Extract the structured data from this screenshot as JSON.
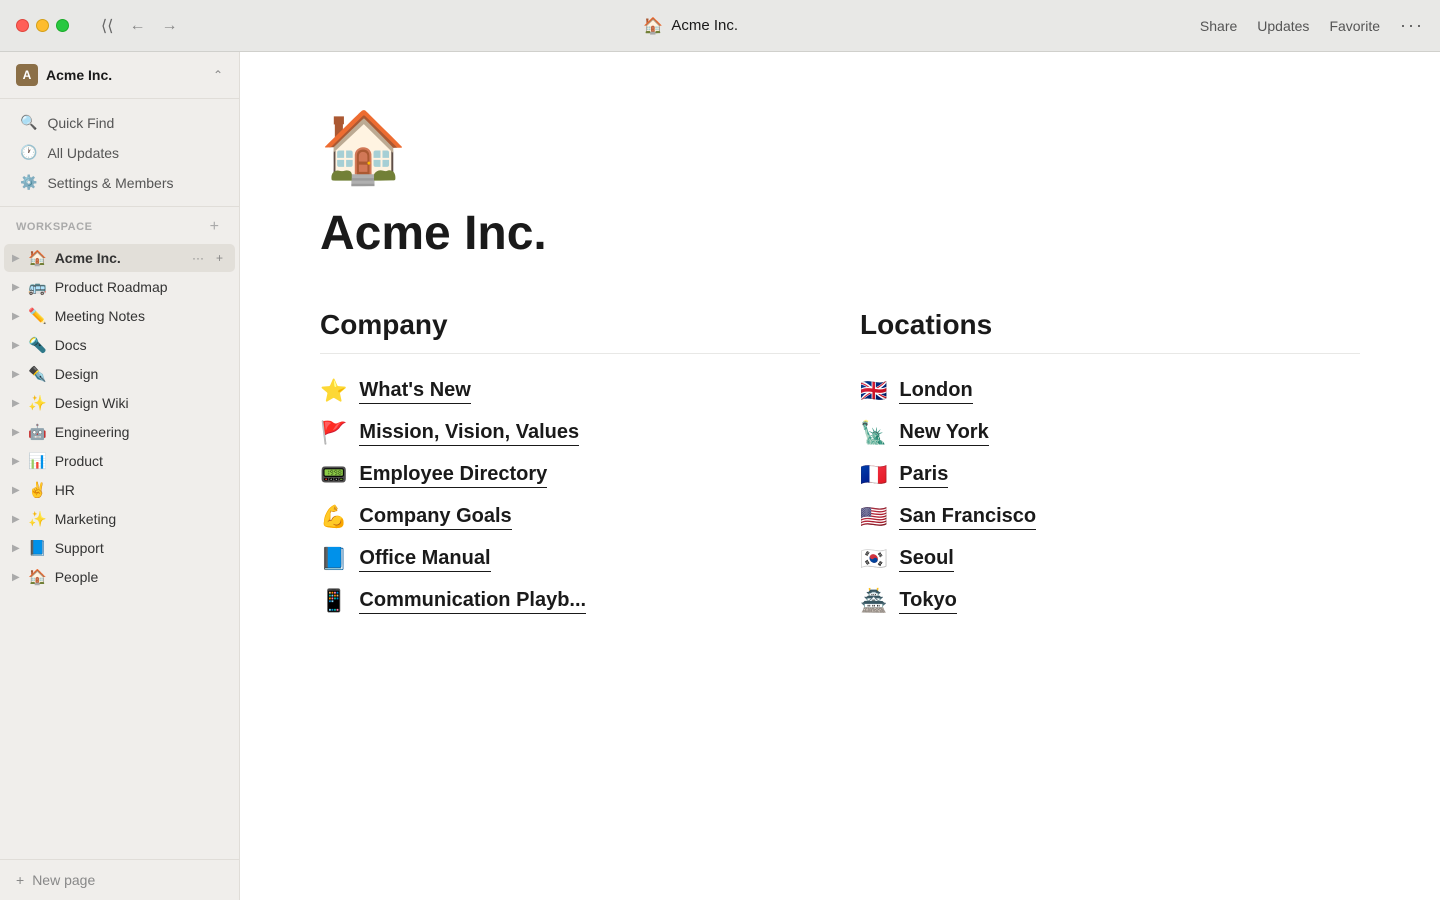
{
  "titlebar": {
    "collapse_label": "⟨⟨",
    "back_label": "←",
    "forward_label": "→",
    "page_emoji": "🏠",
    "page_title": "Acme Inc.",
    "share_label": "Share",
    "updates_label": "Updates",
    "favorite_label": "Favorite",
    "more_label": "···"
  },
  "sidebar": {
    "workspace_icon": "A",
    "workspace_name": "Acme Inc.",
    "nav_items": [
      {
        "id": "quick-find",
        "icon": "🔍",
        "label": "Quick Find"
      },
      {
        "id": "all-updates",
        "icon": "🕐",
        "label": "All Updates"
      },
      {
        "id": "settings",
        "icon": "⚙️",
        "label": "Settings & Members"
      }
    ],
    "section_label": "WORKSPACE",
    "tree_items": [
      {
        "id": "acme-inc",
        "icon": "🏠",
        "label": "Acme Inc.",
        "active": true
      },
      {
        "id": "product-roadmap",
        "icon": "🚌",
        "label": "Product Roadmap",
        "active": false
      },
      {
        "id": "meeting-notes",
        "icon": "✏️",
        "label": "Meeting Notes",
        "active": false
      },
      {
        "id": "docs",
        "icon": "🔦",
        "label": "Docs",
        "active": false
      },
      {
        "id": "design",
        "icon": "✒️",
        "label": "Design",
        "active": false
      },
      {
        "id": "design-wiki",
        "icon": "✨",
        "label": "Design Wiki",
        "active": false
      },
      {
        "id": "engineering",
        "icon": "🤖",
        "label": "Engineering",
        "active": false
      },
      {
        "id": "product",
        "icon": "📊",
        "label": "Product",
        "active": false
      },
      {
        "id": "hr",
        "icon": "✌️",
        "label": "HR",
        "active": false
      },
      {
        "id": "marketing",
        "icon": "✨",
        "label": "Marketing",
        "active": false
      },
      {
        "id": "support",
        "icon": "📘",
        "label": "Support",
        "active": false
      },
      {
        "id": "people",
        "icon": "🏠",
        "label": "People",
        "active": false
      }
    ],
    "new_page_label": "New page"
  },
  "main": {
    "page_emoji": "🏠",
    "page_title": "Acme Inc.",
    "company_section": {
      "title": "Company",
      "items": [
        {
          "id": "whats-new",
          "emoji": "⭐",
          "label": "What's New"
        },
        {
          "id": "mission",
          "emoji": "🚩",
          "label": "Mission, Vision, Values"
        },
        {
          "id": "employee-directory",
          "emoji": "📟",
          "label": "Employee Directory"
        },
        {
          "id": "company-goals",
          "emoji": "💪",
          "label": "Company Goals"
        },
        {
          "id": "office-manual",
          "emoji": "📘",
          "label": "Office Manual"
        },
        {
          "id": "communication-playbook",
          "emoji": "📱",
          "label": "Communication Playb..."
        }
      ]
    },
    "locations_section": {
      "title": "Locations",
      "items": [
        {
          "id": "london",
          "emoji": "🇬🇧",
          "label": "London"
        },
        {
          "id": "new-york",
          "emoji": "🗽",
          "label": "New York"
        },
        {
          "id": "paris",
          "emoji": "🇫🇷",
          "label": "Paris"
        },
        {
          "id": "san-francisco",
          "emoji": "🇺🇸",
          "label": "San Francisco"
        },
        {
          "id": "seoul",
          "emoji": "🇰🇷",
          "label": "Seoul"
        },
        {
          "id": "tokyo",
          "emoji": "🏯",
          "label": "Tokyo"
        }
      ]
    }
  }
}
